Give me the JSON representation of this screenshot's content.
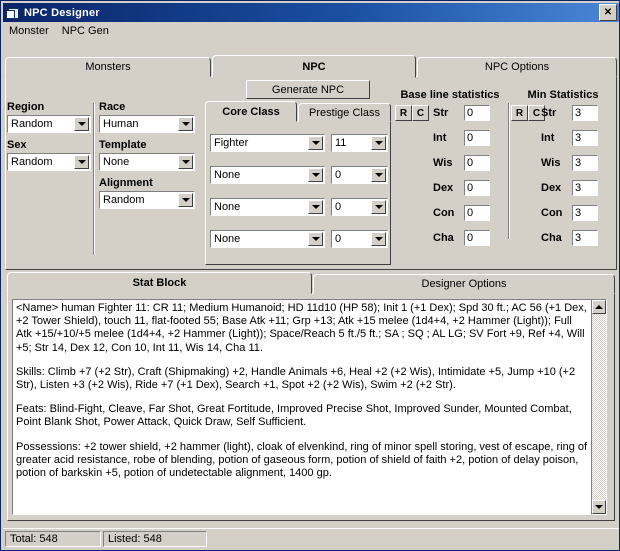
{
  "window": {
    "title": "NPC Designer",
    "icon": "app-window-icon",
    "close_label": "✕"
  },
  "menubar": {
    "items": [
      {
        "label": "Monster"
      },
      {
        "label": "NPC Gen"
      }
    ]
  },
  "main_tabs": [
    {
      "label": "Monsters",
      "active": false
    },
    {
      "label": "NPC",
      "active": true
    },
    {
      "label": "NPC Options",
      "active": false
    }
  ],
  "generate": {
    "label": "Generate NPC"
  },
  "left_group": {
    "region": {
      "label": "Region",
      "value": "Random"
    },
    "sex": {
      "label": "Sex",
      "value": "Random"
    },
    "race": {
      "label": "Race",
      "value": "Human"
    },
    "template": {
      "label": "Template",
      "value": "None"
    },
    "alignment": {
      "label": "Alignment",
      "value": "Random"
    }
  },
  "class_tabs": [
    {
      "label": "Core Class",
      "active": true
    },
    {
      "label": "Prestige Class",
      "active": false
    }
  ],
  "class_rows": [
    {
      "class": "Fighter",
      "level": "11"
    },
    {
      "class": "None",
      "level": "0"
    },
    {
      "class": "None",
      "level": "0"
    },
    {
      "class": "None",
      "level": "0"
    }
  ],
  "statistics": {
    "base": {
      "title": "Base line statistics",
      "buttons": [
        "R",
        "C"
      ],
      "rows": [
        {
          "name": "Str",
          "value": "0"
        },
        {
          "name": "Int",
          "value": "0"
        },
        {
          "name": "Wis",
          "value": "0"
        },
        {
          "name": "Dex",
          "value": "0"
        },
        {
          "name": "Con",
          "value": "0"
        },
        {
          "name": "Cha",
          "value": "0"
        }
      ]
    },
    "min": {
      "title": "Min Statistics",
      "buttons": [
        "R",
        "C"
      ],
      "rows": [
        {
          "name": "Str",
          "value": "3"
        },
        {
          "name": "Int",
          "value": "3"
        },
        {
          "name": "Wis",
          "value": "3"
        },
        {
          "name": "Dex",
          "value": "3"
        },
        {
          "name": "Con",
          "value": "3"
        },
        {
          "name": "Cha",
          "value": "3"
        }
      ]
    }
  },
  "bottom_tabs": [
    {
      "label": "Stat Block",
      "active": true
    },
    {
      "label": "Designer Options",
      "active": false
    }
  ],
  "stat_block": {
    "paragraphs": [
      "<Name>  human Fighter 11: CR 11; Medium Humanoid; HD 11d10  (HP 58); Init 1 (+1 Dex); Spd 30 ft.; AC 56 (+1 Dex, +2 Tower Shield), touch 11, flat-footed 55; Base Atk +11; Grp +13; Atk +15 melee (1d4+4, +2 Hammer (Light)); Full Atk +15/+10/+5 melee (1d4+4, +2 Hammer (Light)); Space/Reach 5 ft./5 ft.; SA ; SQ ; AL LG; SV Fort +9, Ref +4, Will +5; Str 14, Dex 12, Con 10, Int 11, Wis 14, Cha 11.",
      "Skills: Climb +7 (+2 Str), Craft (Shipmaking) +2, Handle Animals +6, Heal +2 (+2 Wis), Intimidate +5, Jump +10 (+2 Str), Listen +3 (+2 Wis), Ride +7 (+1 Dex), Search +1, Spot +2 (+2 Wis), Swim +2 (+2 Str).",
      "Feats: Blind-Fight, Cleave, Far Shot, Great Fortitude, Improved Precise Shot, Improved Sunder, Mounted Combat, Point Blank Shot, Power Attack, Quick Draw, Self Sufficient.",
      "Possessions: +2 tower shield, +2 hammer (light), cloak of elvenkind, ring of minor spell storing, vest of escape, ring of greater acid resistance, robe of blending, potion of gaseous form, potion of shield of faith +2, potion of delay poison, potion of barkskin +5, potion of undetectable alignment, 1400 gp."
    ]
  },
  "statusbar": {
    "total": "Total: 548",
    "listed": "Listed: 548"
  },
  "colors": {
    "face": "#d4d0c8",
    "titlebar_start": "#0a246a",
    "titlebar_end": "#4a86d8",
    "field_bg": "#ffffff",
    "shadow": "#404040",
    "highlight": "#ffffff"
  }
}
